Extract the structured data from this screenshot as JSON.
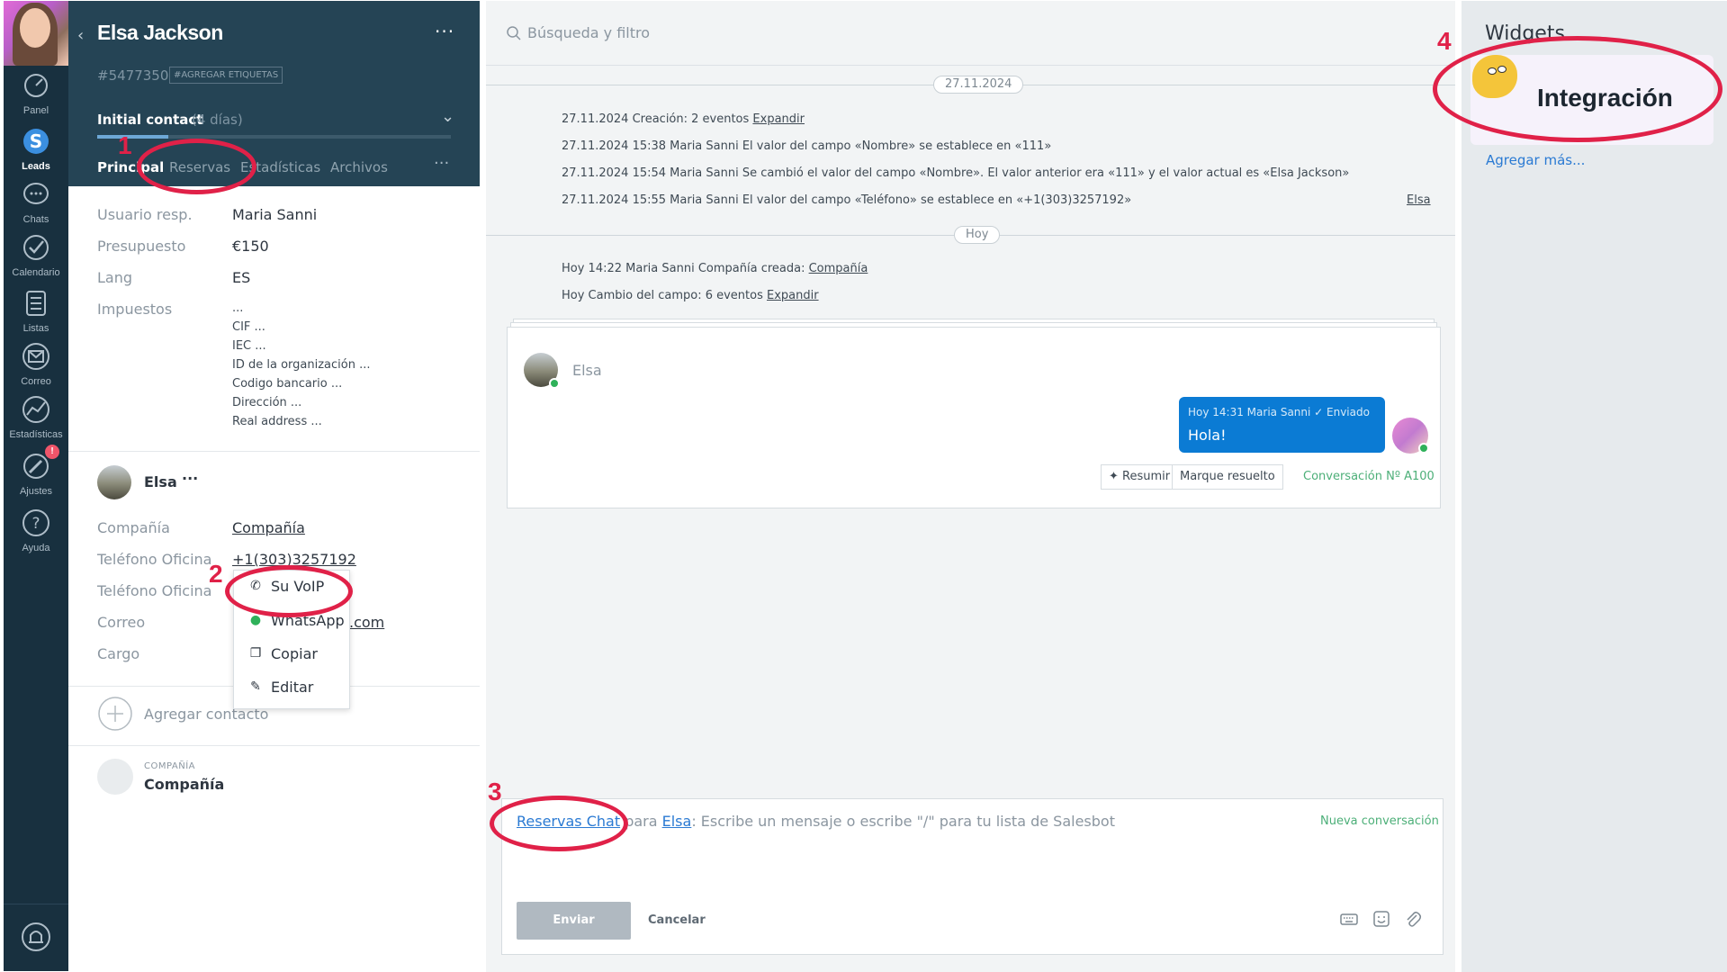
{
  "nav": {
    "items": [
      {
        "label": "Panel",
        "icon": "dashboard-icon"
      },
      {
        "label": "Leads",
        "icon": "leads-dollar-icon",
        "active": true
      },
      {
        "label": "Chats",
        "icon": "chat-bubble-icon"
      },
      {
        "label": "Calendario",
        "icon": "check-circle-icon"
      },
      {
        "label": "Listas",
        "icon": "list-icon"
      },
      {
        "label": "Correo",
        "icon": "mail-icon"
      },
      {
        "label": "Estadísticas",
        "icon": "stats-icon"
      },
      {
        "label": "Ajustes",
        "icon": "settings-wrench-icon",
        "badge": "!"
      },
      {
        "label": "Ayuda",
        "icon": "help-icon"
      }
    ],
    "bell_icon": "notification-bell-icon"
  },
  "card": {
    "lead_name": "Elsa Jackson",
    "lead_id": "#5477350",
    "tags_button": "#AGREGAR ETIQUETAS",
    "stage": "Initial contact",
    "stage_days": "(4 días)",
    "stage_progress_pct": 20,
    "tabs": [
      "Principal",
      "Reservas",
      "Estadísticas",
      "Archivos"
    ],
    "fields": [
      {
        "label": "Usuario resp.",
        "value": "Maria Sanni"
      },
      {
        "label": "Presupuesto",
        "value": "€150"
      },
      {
        "label": "Lang",
        "value": "ES"
      },
      {
        "label": "Impuestos",
        "value": "..."
      }
    ],
    "tax_subfields": [
      "CIF ...",
      "IEC ...",
      "ID de la organización ...",
      "Codigo bancario ...",
      "Dirección ...",
      "Real address ..."
    ],
    "contact": {
      "name": "Elsa",
      "more": "···",
      "fields": [
        {
          "label": "Compañía",
          "value": "Compañía"
        },
        {
          "label": "Teléfono Oficina",
          "value": "+1(303)3257192"
        },
        {
          "label": "Teléfono Oficina",
          "value": ""
        },
        {
          "label": "Correo",
          "value": ".com"
        },
        {
          "label": "Cargo",
          "value": ""
        }
      ]
    },
    "context_menu": [
      "Su VoIP",
      "WhatsApp",
      "Copiar",
      "Editar"
    ],
    "add_contact": "Agregar contacto",
    "company_caption": "COMPAÑÍA",
    "company_name": "Compañía"
  },
  "feed": {
    "search_placeholder": "Búsqueda y filtro",
    "date1": "27.11.2024",
    "events1": [
      {
        "text": "27.11.2024 Creación: 2 eventos ",
        "link": "Expandir"
      },
      {
        "text": "27.11.2024 15:38 Maria Sanni El valor del campo «Nombre» se establece en «111»",
        "link": ""
      },
      {
        "text": "27.11.2024 15:54 Maria Sanni Se cambió el valor del campo «Nombre». El valor anterior era «111» y el valor actual es «Elsa Jackson»",
        "link": ""
      },
      {
        "text": "27.11.2024 15:55 Maria Sanni El valor del campo «Teléfono» se establece en «+1(303)3257192»",
        "link": ""
      }
    ],
    "event_side_link": "Elsa",
    "date2": "Hoy",
    "events2": [
      {
        "text": "Hoy 14:22 Maria Sanni Compañía creada: ",
        "link": "Compañía"
      },
      {
        "text": "Hoy Cambio del campo: 6 eventos ",
        "link": "Expandir"
      }
    ],
    "chat": {
      "contact": "Elsa",
      "bubble_meta": "Hoy 14:31 Maria Sanni ✓ Enviado",
      "bubble_text": "Hola!",
      "summarize": "Resumir",
      "mark_resolved": "Marque resuelto",
      "conversation": "Conversación Nº A100"
    },
    "composer": {
      "channel": "Reservas Chat",
      "para": "para",
      "recipient": "Elsa",
      "placeholder": ": Escribe un mensaje o escribe \"/\" para tu lista de Salesbot",
      "new_conversation": "Nueva conversación",
      "send": "Enviar",
      "cancel": "Cancelar"
    }
  },
  "widgets": {
    "title": "Widgets",
    "integration": "Integración",
    "add_more": "Agregar más..."
  },
  "annotations": [
    "1",
    "2",
    "3",
    "4"
  ],
  "colors": {
    "nav_bg": "#18303f",
    "card_header_bg": "#254455",
    "accent_blue": "#0b7bd4",
    "annotation_red": "#e02148",
    "green": "#4caf78"
  }
}
